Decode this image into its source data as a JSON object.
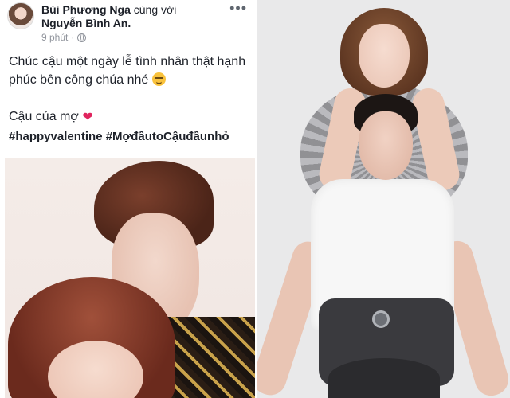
{
  "post": {
    "author": "Bùi Phương Nga",
    "with_text": "cùng với",
    "tagged": "Nguyễn Bình An.",
    "time": "9 phút",
    "more_label": "•••",
    "line1": "Chúc cậu một ngày lễ tình nhân thật hạnh",
    "line2": "phúc bên công chúa nhé",
    "line3": "Cậu của mợ",
    "hashtag1": "#happyvalentine",
    "hashtag2": "#MợđầutoCậuđầunhỏ",
    "privacy_icon": "globe-icon",
    "emoji_icon": "smiling-face-icon",
    "heart_icon": "red-heart-icon"
  },
  "colors": {
    "text": "#1d2129",
    "meta": "#90949c",
    "heart": "#e0245e",
    "right_bg": "#e9e9ea"
  }
}
